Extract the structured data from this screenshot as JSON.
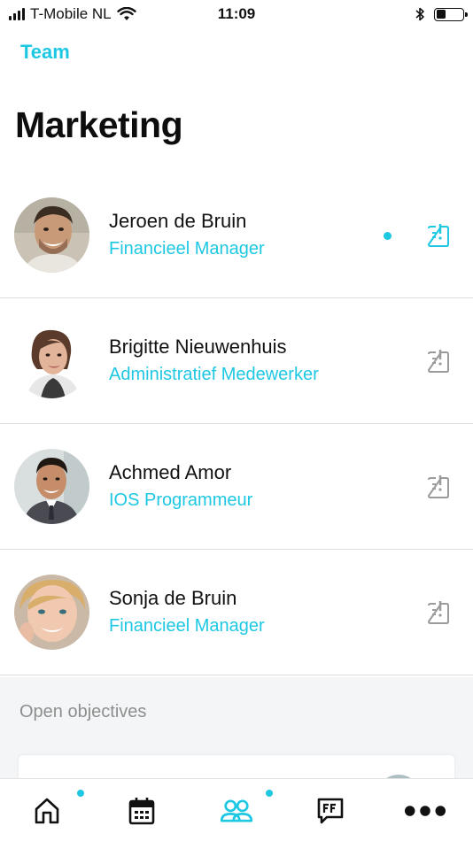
{
  "status_bar": {
    "carrier": "T-Mobile NL",
    "time": "11:09",
    "battery_level": 0.35
  },
  "header": {
    "back_label": "Team",
    "title": "Marketing"
  },
  "team": [
    {
      "name": "Jeroen de Bruin",
      "role": "Financieel Manager",
      "unread": true
    },
    {
      "name": "Brigitte Nieuwenhuis",
      "role": "Administratief Medewerker",
      "unread": false
    },
    {
      "name": "Achmed Amor",
      "role": "IOS Programmeur",
      "unread": false
    },
    {
      "name": "Sonja de Bruin",
      "role": "Financieel Manager",
      "unread": false
    }
  ],
  "objectives": {
    "title": "Open objectives"
  },
  "tab_bar": {
    "tabs": [
      {
        "icon": "home-icon",
        "badge": true,
        "active": false
      },
      {
        "icon": "calendar-icon",
        "badge": false,
        "active": false
      },
      {
        "icon": "team-icon",
        "badge": true,
        "active": true
      },
      {
        "icon": "feedback-icon",
        "badge": false,
        "active": false
      },
      {
        "icon": "more-icon",
        "badge": false,
        "active": false
      }
    ]
  },
  "colors": {
    "accent": "#1ec8e3",
    "divider": "#dedede",
    "inactive_icon": "#9b9b9b",
    "background_section": "#f3f5f6"
  }
}
